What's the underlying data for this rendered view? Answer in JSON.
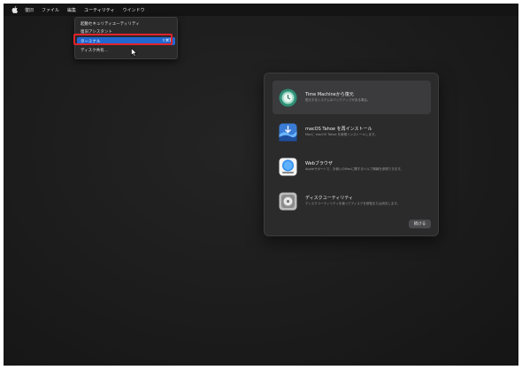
{
  "menubar": {
    "items": [
      "復旧",
      "ファイル",
      "編集",
      "ユーティリティ",
      "ウインドウ"
    ]
  },
  "dropdown": {
    "items": [
      {
        "label": "起動セキュリティユーティリティ"
      },
      {
        "label": "復旧アシスタント"
      },
      {
        "label": "ターミナル",
        "shortcut": "⇧⌘T"
      },
      {
        "label": "ディスク共有..."
      }
    ]
  },
  "recovery_panel": {
    "options": [
      {
        "title": "Time Machineから復元",
        "subtitle": "復元するシステムのバックアップがある場合。",
        "icon": "time-machine-icon"
      },
      {
        "title": "macOS Tahoe を再インストール",
        "subtitle": "Macに macOS Tahoe を新規インストールします。",
        "icon": "macos-installer-icon"
      },
      {
        "title": "Webブラウザ",
        "subtitle": "Appleサポートで、お使いのMacに関するヘルプ情報を参照できます。",
        "icon": "safari-icon"
      },
      {
        "title": "ディスクユーティリティ",
        "subtitle": "ディスクユーティリティを使ってディスクを修復または消去します。",
        "icon": "disk-utility-icon"
      }
    ],
    "continue_label": "続ける"
  },
  "colors": {
    "menu_highlight": "#2367d1",
    "annotation_box": "#e0232a"
  }
}
